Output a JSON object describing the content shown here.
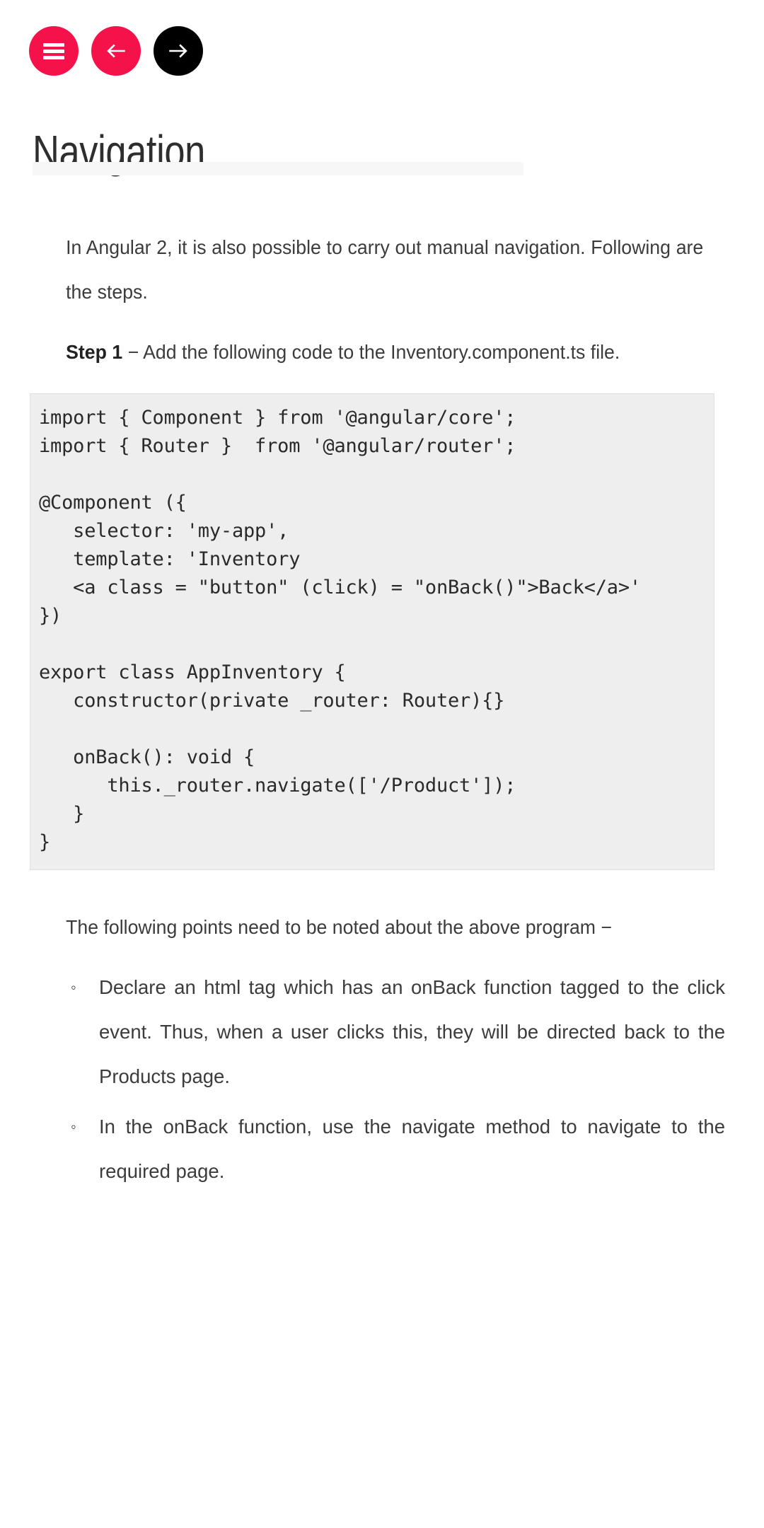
{
  "toolbar": {
    "menu_button": {
      "label": "Menu",
      "icon": "hamburger-icon",
      "color": "#f5124a"
    },
    "prev_button": {
      "label": "Previous",
      "icon": "arrow-left-icon",
      "color": "#f5124a"
    },
    "next_button": {
      "label": "Next",
      "icon": "arrow-right-icon",
      "color": "#000000"
    }
  },
  "header": {
    "title": "Navigation"
  },
  "article": {
    "intro": "In Angular 2, it is also possible to carry out manual navigation. Following are the steps.",
    "step_label": "Step 1",
    "step_text": " − Add the following code to the Inventory.component.ts file.",
    "code": "import { Component } from '@angular/core';\nimport { Router }  from '@angular/router';\n\n@Component ({\n   selector: 'my-app',\n   template: 'Inventory\n   <a class = \"button\" (click) = \"onBack()\">Back</a>'\n})\n\nexport class AppInventory {\n   constructor(private _router: Router){}\n\n   onBack(): void {\n      this._router.navigate(['/Product']);\n   }\n}",
    "note_intro": "The following points need to be noted about the above program −",
    "bullets": [
      {
        "marker": "◦",
        "text": "Declare an html tag which has an onBack function tagged to the click event. Thus, when a user clicks this, they will be directed back to the Products page."
      },
      {
        "marker": "◦",
        "text": "In the onBack function, use the navigate method to navigate to the required page."
      }
    ]
  }
}
